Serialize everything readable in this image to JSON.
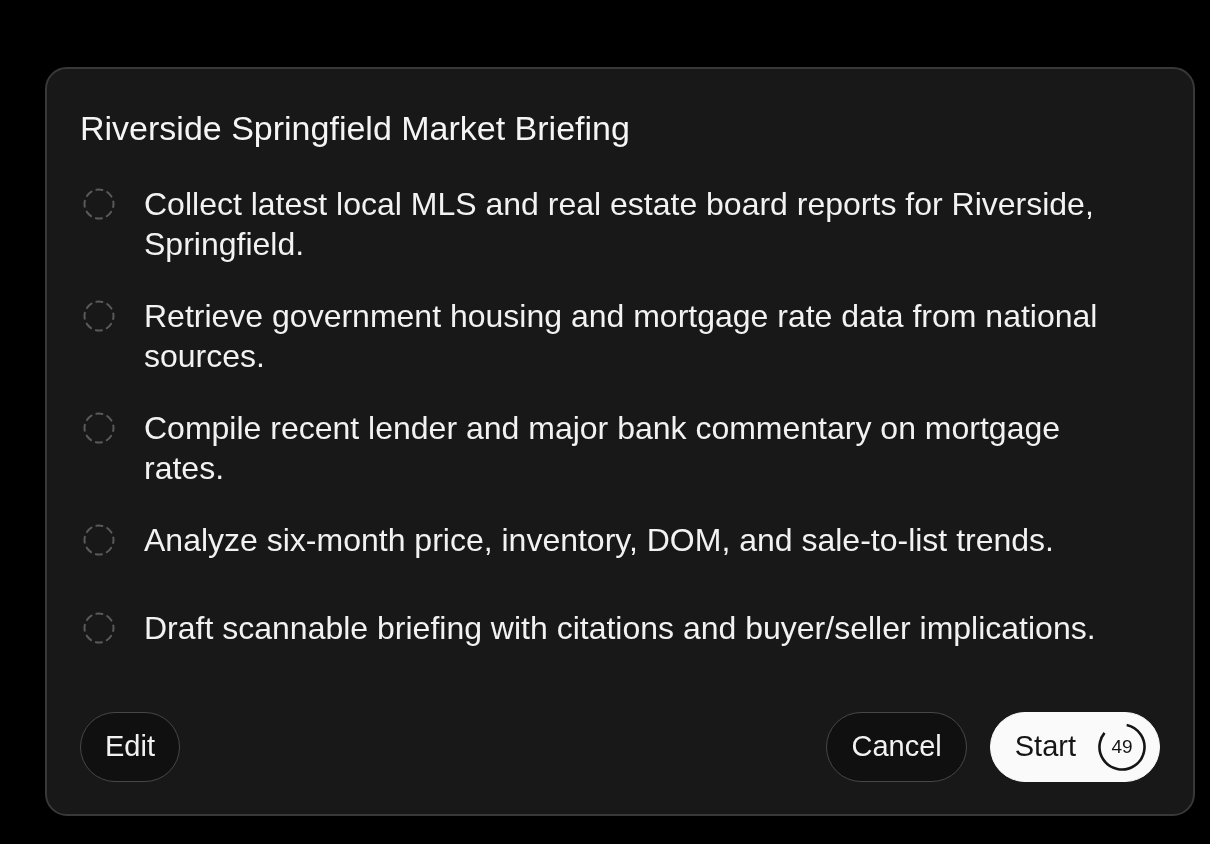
{
  "title": "Riverside Springfield Market Briefing",
  "steps": [
    {
      "text": "Collect latest local MLS and real estate board reports for Riverside, Springfield.",
      "done": false
    },
    {
      "text": "Retrieve government housing and mortgage rate data from national sources.",
      "done": false
    },
    {
      "text": "Compile recent lender and major bank commentary on mortgage rates.",
      "done": false
    },
    {
      "text": "Analyze six-month price, inventory, DOM, and sale-to-list trends.",
      "done": false
    },
    {
      "text": "Draft scannable briefing with citations and buyer/seller implications.",
      "done": false
    }
  ],
  "buttons": {
    "left": [
      {
        "label": "Edit",
        "kind": "outline"
      }
    ],
    "right": [
      {
        "label": "Cancel",
        "kind": "outline"
      },
      {
        "label": "Start",
        "kind": "filled",
        "countdown": "49"
      }
    ]
  }
}
